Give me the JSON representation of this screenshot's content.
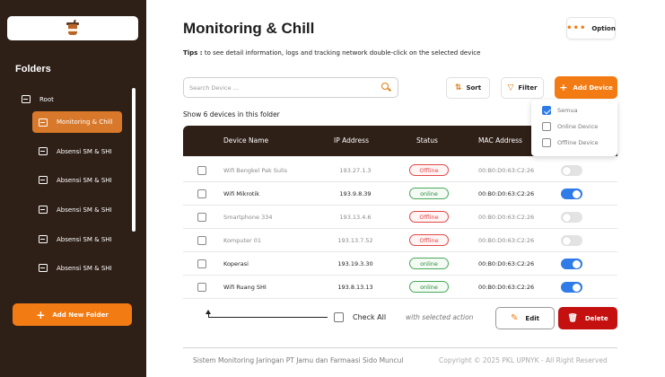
{
  "sidebar": {
    "folders_title": "Folders",
    "root_label": "Root",
    "items": [
      {
        "label": "Monitoring & Chill",
        "active": true
      },
      {
        "label": "Absensi SM & SHI"
      },
      {
        "label": "Absensi SM & SHI"
      },
      {
        "label": "Absensi SM & SHI"
      },
      {
        "label": "Absensi SM & SHI"
      },
      {
        "label": "Absensi SM & SHI"
      }
    ],
    "add_folder_label": "Add New Folder"
  },
  "header": {
    "title": "Monitoring & Chill",
    "option_label": "Option"
  },
  "tips": {
    "label": "Tips :",
    "text": " to see detail information, logs and tracking network double-click on the selected device"
  },
  "toolbar": {
    "search_placeholder": "Search Device ...",
    "sort_label": "Sort",
    "filter_label": "Filter",
    "add_device_label": "Add Device"
  },
  "filter_menu": {
    "items": [
      {
        "label": "Semua",
        "checked": true
      },
      {
        "label": "Online Device",
        "checked": false
      },
      {
        "label": "Offline Device",
        "checked": false
      }
    ]
  },
  "show_count": "Show 6 devices in this folder",
  "table": {
    "columns": [
      "Device Name",
      "IP Address",
      "Status",
      "MAC Address"
    ],
    "rows": [
      {
        "name": "Wifi Bengkel Pak Sulis",
        "ip": "193.27.1.3",
        "status": "Offline",
        "mac": "00:B0:D0:63:C2:26",
        "enabled": false
      },
      {
        "name": "Wifi Mikrotik",
        "ip": "193.9.8.39",
        "status": "online",
        "mac": "00:B0:D0:63:C2:26",
        "enabled": true
      },
      {
        "name": "Smartphone 334",
        "ip": "193.13.4.6",
        "status": "Offline",
        "mac": "00:B0:D0:63:C2:26",
        "enabled": false
      },
      {
        "name": "Komputer 01",
        "ip": "193.13.7.52",
        "status": "Offline",
        "mac": "00:B0:D0:63:C2:26",
        "enabled": false
      },
      {
        "name": "Koperasi",
        "ip": "193.19.3.30",
        "status": "online",
        "mac": "00:B0:D0:63:C2:26",
        "enabled": true
      },
      {
        "name": "Wifi Ruang SHI",
        "ip": "193.8.13.13",
        "status": "online",
        "mac": "00:B0:D0:63:C2:26",
        "enabled": true
      }
    ]
  },
  "bulk": {
    "check_all_label": "Check All",
    "with_selected_label": "with selected action",
    "edit_label": "Edit",
    "delete_label": "Delete"
  },
  "footer": {
    "left": "Sistem Monitoring Jaringan PT Jamu dan Farmaasi Sido Muncul",
    "right": "Copyright © 2025 PKL UPNYK  - All Right Reserved"
  },
  "colors": {
    "sidebar_bg": "#2e1f17",
    "accent": "#f37b13",
    "danger": "#c51010",
    "toggle_on": "#2f7be8"
  }
}
